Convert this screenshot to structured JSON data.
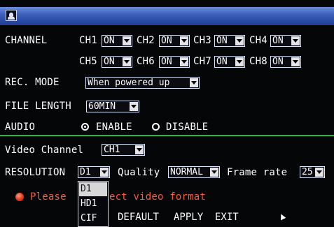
{
  "channel": {
    "label": "CHANNEL",
    "items": [
      {
        "name": "CH1",
        "value": "ON"
      },
      {
        "name": "CH2",
        "value": "ON"
      },
      {
        "name": "CH3",
        "value": "ON"
      },
      {
        "name": "CH4",
        "value": "ON"
      },
      {
        "name": "CH5",
        "value": "ON"
      },
      {
        "name": "CH6",
        "value": "ON"
      },
      {
        "name": "CH7",
        "value": "ON"
      },
      {
        "name": "CH8",
        "value": "ON"
      }
    ]
  },
  "rec_mode": {
    "label": "REC. MODE",
    "value": "When powered up"
  },
  "file_length": {
    "label": "FILE LENGTH",
    "value": "60MIN"
  },
  "audio": {
    "label": "AUDIO",
    "enable_label": "ENABLE",
    "disable_label": "DISABLE",
    "selected": "ENABLE"
  },
  "video_channel": {
    "label": "Video Channel",
    "value": "CH1"
  },
  "resolution": {
    "label": "RESOLUTION",
    "value": "D1",
    "options": [
      "D1",
      "HD1",
      "CIF"
    ],
    "highlighted": "D1"
  },
  "quality": {
    "label": "Quality",
    "value": "NORMAL"
  },
  "frame_rate": {
    "label": "Frame rate",
    "value": "25"
  },
  "message": {
    "text_before": "Please",
    "text_after": "ect video format"
  },
  "buttons": {
    "default": "DEFAULT",
    "apply": "APPLY",
    "exit": "EXIT"
  },
  "colors": {
    "title_bar": "#3a5cb8",
    "divider": "#22c03a",
    "warning": "#ff5a3a"
  }
}
